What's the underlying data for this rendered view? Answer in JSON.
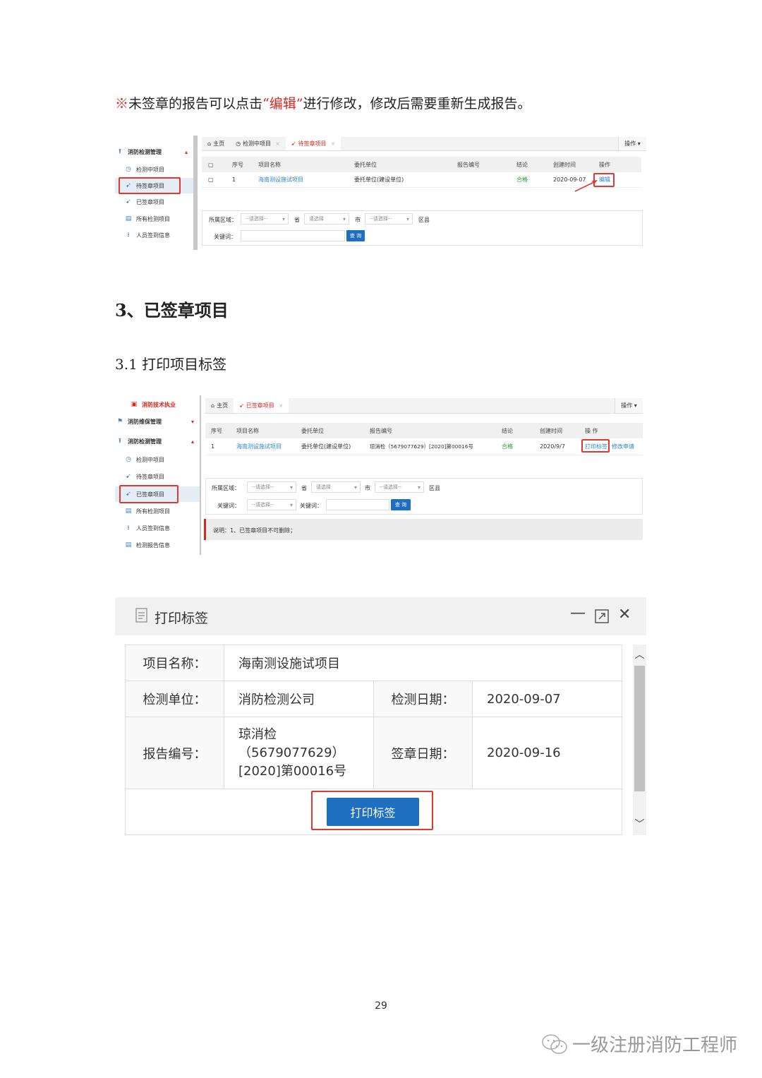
{
  "note": {
    "mark": "※",
    "before": "未签章的报告可以点击",
    "quoted": "“编辑”",
    "after": "进行修改，修改后需要重新生成报告。"
  },
  "section_title": "3、已签章项目",
  "subsection_title": "3.1 打印项目标签",
  "shot1": {
    "sidebar": {
      "group": "消防检测管理",
      "items": [
        "检测中项目",
        "待签章项目",
        "已签章项目",
        "所有检测项目",
        "人员签到信息"
      ]
    },
    "tabs": [
      "主页",
      "检测中项目",
      "待签章项目"
    ],
    "ops": "操作 ▾",
    "columns": [
      "序号",
      "项目名称",
      "委托单位",
      "报告编号",
      "结论",
      "创建时间",
      "操作"
    ],
    "row": {
      "no": "1",
      "name": "海南测设施试项目",
      "client": "委托单位(建设单位)",
      "report": "",
      "result": "合格",
      "created": "2020-09-07",
      "action": "编辑"
    },
    "filter": {
      "area_label": "所属区域：",
      "sel1": "--请选择--",
      "province": "省",
      "sel2": "请选择",
      "city": "市",
      "sel3": "--请选择--",
      "district": "区县",
      "keyword_label": "关键词：",
      "search": "查 询"
    }
  },
  "shot2": {
    "sidebar": {
      "items": [
        "消防技术执业",
        "消防维保管理",
        "消防检测管理",
        "检测中项目",
        "待签章项目",
        "已签章项目",
        "所有检测项目",
        "人员签到信息",
        "检测报告信息"
      ]
    },
    "tabs": [
      "主页",
      "已签章项目"
    ],
    "ops": "操作 ▾",
    "columns": [
      "序号",
      "项目名称",
      "委托单位",
      "报告编号",
      "结论",
      "创建时间",
      "操 作"
    ],
    "row": {
      "no": "1",
      "name": "海南测设施试项目",
      "client": "委托单位(建设单位)",
      "report": "琼消检（5679077629）[2020]第00016号",
      "result": "合格",
      "created": "2020/9/7",
      "action1": "打印标签",
      "action2": "修改申请"
    },
    "filter": {
      "area_label": "所属区域：",
      "sel1": "--请选择--",
      "province": "省",
      "sel2": "请选择",
      "city": "市",
      "sel3": "--请选择--",
      "district": "区县",
      "keyword_label": "关键词：",
      "sel4": "--请选择--",
      "keyword_label2": "关键词：",
      "search": "查 询"
    },
    "note": "说明：1、已签章项目不可删除；"
  },
  "dialog": {
    "title": "打印标签",
    "rows": {
      "name_label": "项目名称：",
      "name_value": "海南测设施试项目",
      "unit_label": "检测单位：",
      "unit_value": "消防检测公司",
      "date_label": "检测日期：",
      "date_value": "2020-09-07",
      "report_label": "报告编号：",
      "report_line1": "琼消检",
      "report_line2": "（5679077629）",
      "report_line3": "[2020]第00016号",
      "sign_label": "签章日期：",
      "sign_value": "2020-09-16"
    },
    "print_button": "打印标签"
  },
  "page_number": "29",
  "watermark": "一级注册消防工程师",
  "colors": {
    "accent_red": "#d9251c",
    "primary_blue": "#1f6fc1",
    "link_blue": "#2a85d0",
    "pass_green": "#2a9d3a"
  }
}
